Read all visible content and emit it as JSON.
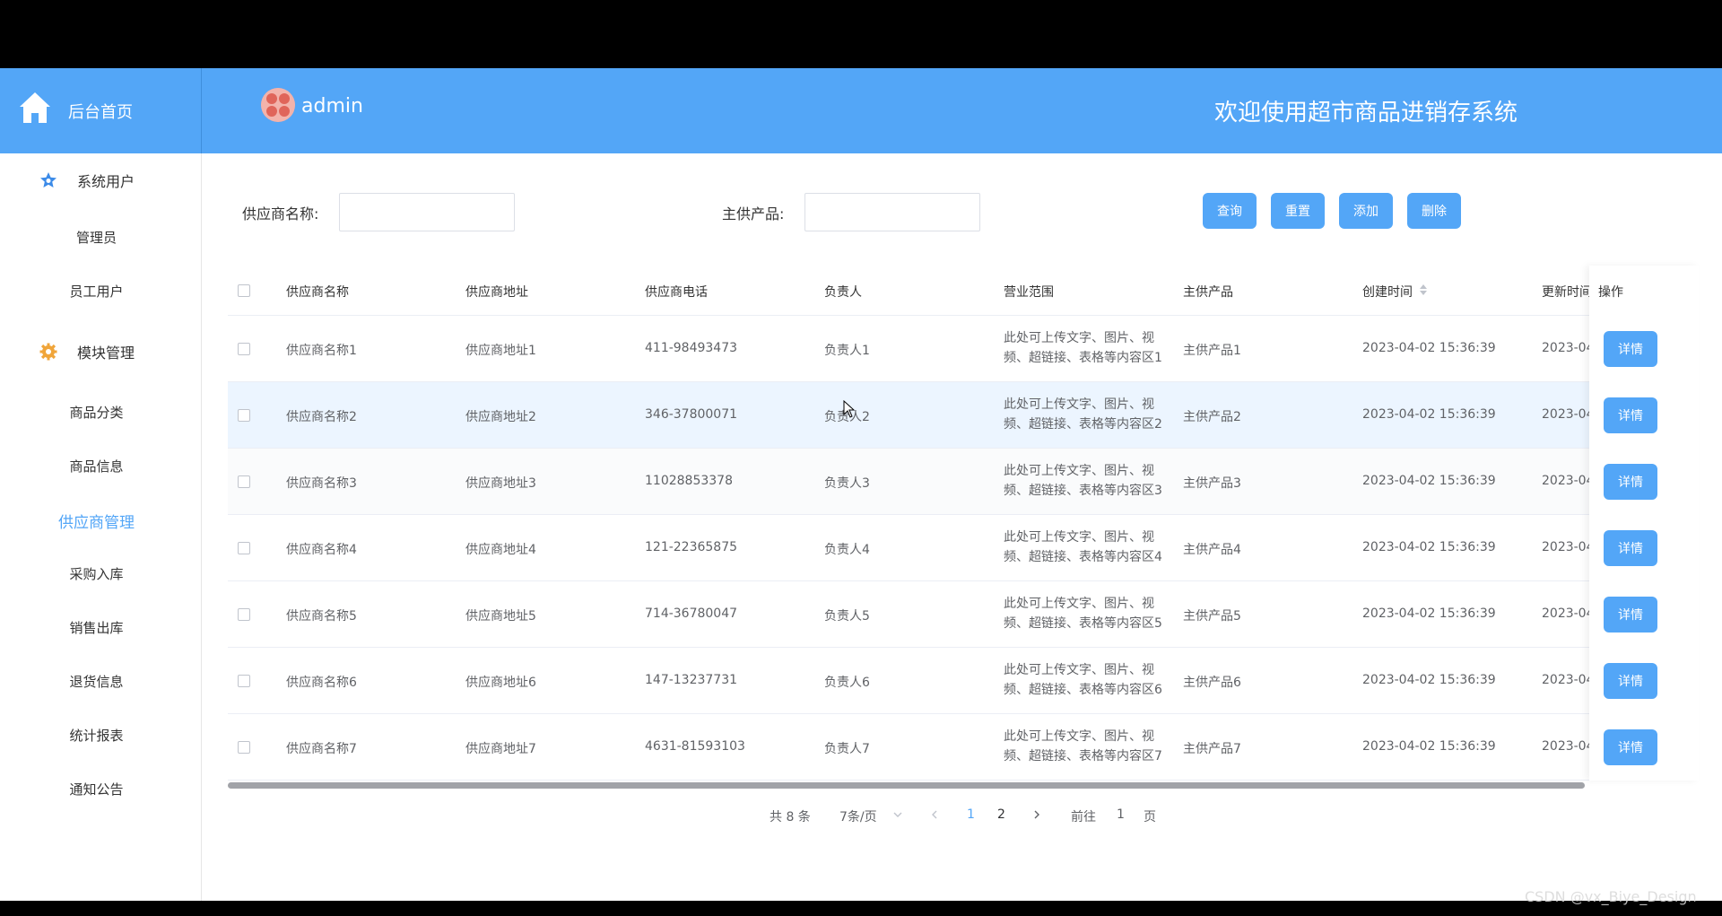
{
  "header": {
    "home_label": "后台首页",
    "user_name": "admin",
    "welcome": "欢迎使用超市商品进销存系统"
  },
  "sidebar": {
    "group_users": "系统用户",
    "items_users": [
      "管理员",
      "员工用户"
    ],
    "group_modules": "模块管理",
    "items_modules": [
      "商品分类",
      "商品信息",
      "供应商管理",
      "采购入库",
      "销售出库",
      "退货信息",
      "统计报表",
      "通知公告"
    ],
    "active": "供应商管理"
  },
  "search": {
    "supplier_name_label": "供应商名称:",
    "main_product_label": "主供产品:",
    "supplier_name_value": "",
    "main_product_value": ""
  },
  "buttons": {
    "query": "查询",
    "reset": "重置",
    "add": "添加",
    "delete": "删除"
  },
  "table": {
    "headers": [
      "供应商名称",
      "供应商地址",
      "供应商电话",
      "负责人",
      "营业范围",
      "主供产品",
      "创建时间",
      "更新时间",
      "操作"
    ],
    "rows": [
      {
        "name": "供应商名称1",
        "address": "供应商地址1",
        "phone": "411-98493473",
        "owner": "负责人1",
        "scope": "此处可上传文字、图片、视频、超链接、表格等内容区1",
        "product": "主供产品1",
        "created": "2023-04-02 15:36:39",
        "updated": "2023-04"
      },
      {
        "name": "供应商名称2",
        "address": "供应商地址2",
        "phone": "346-37800071",
        "owner": "负责人2",
        "scope": "此处可上传文字、图片、视频、超链接、表格等内容区2",
        "product": "主供产品2",
        "created": "2023-04-02 15:36:39",
        "updated": "2023-04"
      },
      {
        "name": "供应商名称3",
        "address": "供应商地址3",
        "phone": "11028853378",
        "owner": "负责人3",
        "scope": "此处可上传文字、图片、视频、超链接、表格等内容区3",
        "product": "主供产品3",
        "created": "2023-04-02 15:36:39",
        "updated": "2023-04"
      },
      {
        "name": "供应商名称4",
        "address": "供应商地址4",
        "phone": "121-22365875",
        "owner": "负责人4",
        "scope": "此处可上传文字、图片、视频、超链接、表格等内容区4",
        "product": "主供产品4",
        "created": "2023-04-02 15:36:39",
        "updated": "2023-04"
      },
      {
        "name": "供应商名称5",
        "address": "供应商地址5",
        "phone": "714-36780047",
        "owner": "负责人5",
        "scope": "此处可上传文字、图片、视频、超链接、表格等内容区5",
        "product": "主供产品5",
        "created": "2023-04-02 15:36:39",
        "updated": "2023-04"
      },
      {
        "name": "供应商名称6",
        "address": "供应商地址6",
        "phone": "147-13237731",
        "owner": "负责人6",
        "scope": "此处可上传文字、图片、视频、超链接、表格等内容区6",
        "product": "主供产品6",
        "created": "2023-04-02 15:36:39",
        "updated": "2023-04"
      },
      {
        "name": "供应商名称7",
        "address": "供应商地址7",
        "phone": "4631-81593103",
        "owner": "负责人7",
        "scope": "此处可上传文字、图片、视频、超链接、表格等内容区7",
        "product": "主供产品7",
        "created": "2023-04-02 15:36:39",
        "updated": "2023-04"
      }
    ],
    "detail_label": "详情"
  },
  "pagination": {
    "total": "共 8 条",
    "page_size": "7条/页",
    "pages": [
      "1",
      "2"
    ],
    "current": "1",
    "goto_prefix": "前往",
    "goto_value": "1",
    "goto_suffix": "页"
  },
  "watermark": "CSDN @vx_Biye_Design",
  "colors": {
    "primary": "#53a6f7",
    "header_bg": "#53a6f7"
  },
  "icons": {
    "home": "home-icon",
    "users_group": "star-badge-icon",
    "modules_group": "gear-icon",
    "sort": "sort-caret-icon",
    "prev": "chevron-left-icon",
    "next": "chevron-right-icon",
    "dropdown": "chevron-down-icon"
  }
}
